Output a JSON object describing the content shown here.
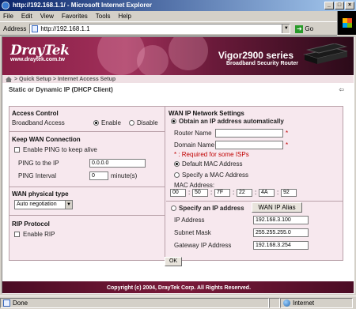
{
  "window": {
    "title": "http://192.168.1.1/ - Microsoft Internet Explorer",
    "controls": [
      "_",
      "□",
      "×"
    ]
  },
  "menu": [
    "File",
    "Edit",
    "View",
    "Favorites",
    "Tools",
    "Help"
  ],
  "address": {
    "label": "Address",
    "url": "http://192.168.1.1",
    "go": "Go"
  },
  "banner": {
    "logo": "DrayTek",
    "logo_url": "www.draytek.com.tw",
    "product": "Vigor2900 series",
    "tagline": "Broadband Security Router"
  },
  "breadcrumb": "> Quick Setup > Internet Access Setup",
  "subtitle": "Static or Dynamic IP (DHCP Client)",
  "left": {
    "access": {
      "title": "Access Control",
      "label": "Broadband Access",
      "enable": "Enable",
      "disable": "Disable"
    },
    "keep": {
      "title": "Keep WAN Connection",
      "ping_chk": "Enable PING to keep alive",
      "ping_to": "PING to the IP",
      "ping_ip": "0.0.0.0",
      "ping_interval": "PING Interval",
      "interval_val": "0",
      "unit": "minute(s)"
    },
    "wan": {
      "title": "WAN physical type",
      "value": "Auto negotiation"
    },
    "rip": {
      "title": "RIP Protocol",
      "chk": "Enable RIP"
    }
  },
  "right": {
    "title": "WAN IP Network Settings",
    "obtain": "Obtain an IP address automatically",
    "router_name": "Router Name",
    "domain_name": "Domain Name",
    "required": "* : Required for some ISPs",
    "default_mac": "Default MAC Address",
    "specify_mac": "Specify a MAC Address",
    "mac_label": "MAC Address:",
    "mac": [
      "00",
      "50",
      "7F",
      "22",
      "4A",
      "92"
    ],
    "specify_ip": "Specify an IP address",
    "alias_btn": "WAN IP Alias",
    "ip_label": "IP Address",
    "ip": "192.168.3.100",
    "mask_label": "Subnet Mask",
    "mask": "255.255.255.0",
    "gw_label": "Gateway IP Address",
    "gw": "192.168.3.254"
  },
  "ok": "OK",
  "footer": "Copyright (c) 2004, DrayTek Corp. All Rights Reserved.",
  "status": {
    "left": "Done",
    "zone": "Internet"
  }
}
